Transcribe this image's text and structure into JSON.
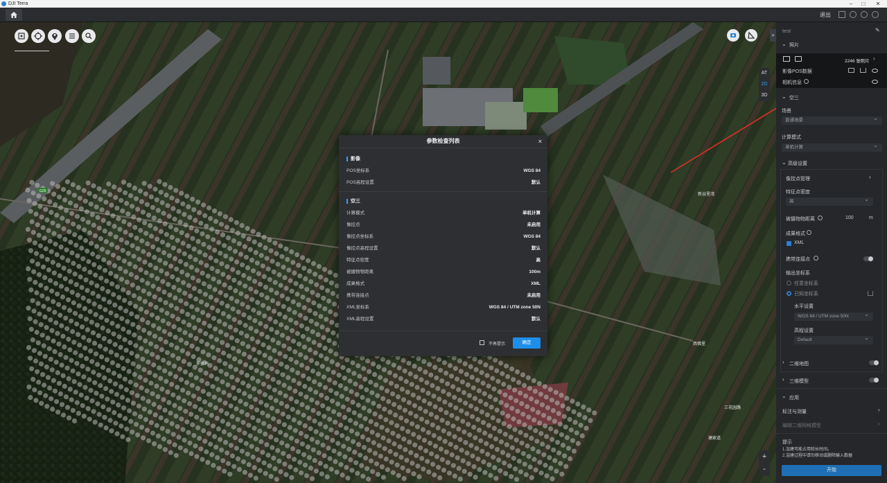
{
  "window": {
    "title": "DJI Terra"
  },
  "topbar": {
    "exit_label": "退出"
  },
  "map": {
    "view_modes": [
      "AT",
      "2D",
      "3D"
    ],
    "active_view_mode": "2D",
    "zoom_in": "+",
    "zoom_out": "-",
    "place_labels": [
      "新谷里湾",
      "东坑里湾",
      "西佛里",
      "罗家坞",
      "三花园路",
      "塘家道"
    ],
    "road_label": "G25"
  },
  "modal": {
    "title": "参数检查列表",
    "close": "×",
    "sections": [
      {
        "title": "影像",
        "rows": [
          {
            "key": "POS坐标系",
            "value": "WGS 84"
          },
          {
            "key": "POS高程设置",
            "value": "默认"
          }
        ]
      },
      {
        "title": "空三",
        "rows": [
          {
            "key": "计算模式",
            "value": "单机计算"
          },
          {
            "key": "像控点",
            "value": "未启用"
          },
          {
            "key": "像控点坐标系",
            "value": "WGS 84"
          },
          {
            "key": "像控点高程设置",
            "value": "默认"
          },
          {
            "key": "特征点密度",
            "value": "高"
          },
          {
            "key": "被摄物物距离",
            "value": "100m"
          },
          {
            "key": "成果格式",
            "value": "XML"
          },
          {
            "key": "携带连接点",
            "value": "未启用"
          },
          {
            "key": "XML坐标系",
            "value": "WGS 84 / UTM zone 50N"
          },
          {
            "key": "XML高程设置",
            "value": "默认"
          }
        ]
      }
    ],
    "dont_show_again": "不再提示",
    "confirm": "确定"
  },
  "panel": {
    "project_name": "test",
    "photos_section": "照片",
    "photo_count": "2246 张照片",
    "pos_data": "影像POS数据",
    "camera_info": "相机信息",
    "aerotriangulation": "空三",
    "scene_label": "场景",
    "scene_value": "普通场景",
    "compute_mode_label": "计算模式",
    "compute_mode_value": "单机计算",
    "advanced": "高级设置",
    "gcp_management": "像控点管理",
    "feature_density_label": "特征点密度",
    "feature_density_value": "高",
    "object_distance_label": "被摄物物距离",
    "object_distance_value": "100",
    "object_distance_unit": "m",
    "output_format_label": "成果格式",
    "output_format_value": "XML",
    "tie_points_label": "携带连接点",
    "output_crs_label": "输出坐标系",
    "crs_option_1": "任意坐标系",
    "crs_option_2": "已知坐标系",
    "horizontal_label": "水平设置",
    "horizontal_value": "WGS 84 / UTM zone 50N",
    "vertical_label": "高程设置",
    "vertical_value": "Default",
    "map2d": "二维地图",
    "model3d": "三维模型",
    "apply": "应用",
    "annotate": "标注与测量",
    "edit_model": "编辑二维网格模型",
    "tips_title": "提示",
    "tip1": "1.渲建可能占用较长时间。",
    "tip2": "2.渲建过程中请勿移动或删除输入数据",
    "start_button": "开始"
  },
  "colors": {
    "accent": "#1e8fe8",
    "arrow": "#e03127",
    "panel_bg": "#25272a",
    "modal_bg": "#2d2f32"
  }
}
